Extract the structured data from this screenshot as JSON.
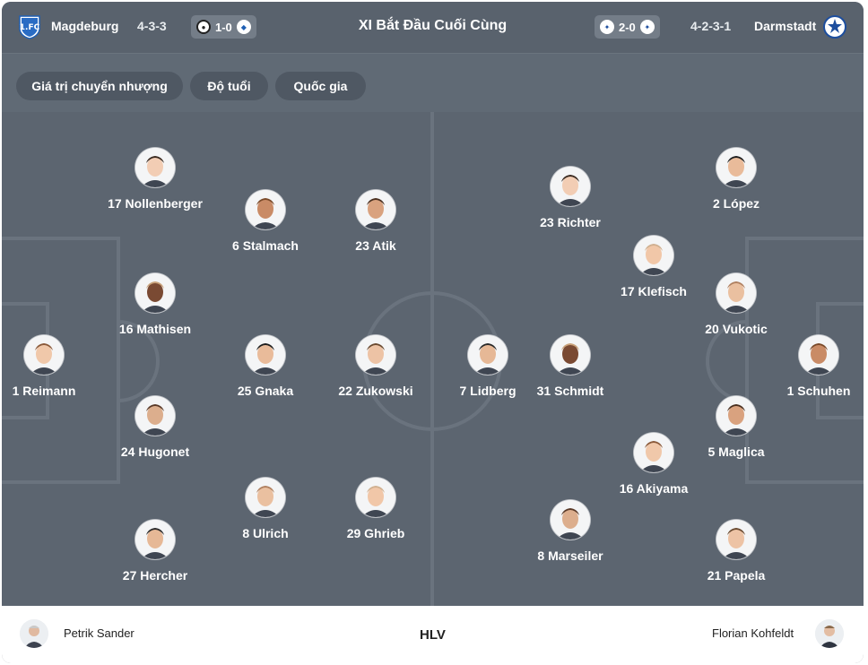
{
  "header": {
    "title": "XI Bắt Đầu Cuối Cùng",
    "home": {
      "name": "Magdeburg",
      "formation": "4-3-3",
      "logo_icon": "magdeburg-crest-icon",
      "color": "#1f5fb4"
    },
    "away": {
      "name": "Darmstadt",
      "formation": "4-2-3-1",
      "logo_icon": "darmstadt-crest-icon",
      "color": "#1d4e9e"
    },
    "home_result": {
      "score": "1-0"
    },
    "away_result": {
      "score": "2-0"
    }
  },
  "filters": [
    {
      "label": "Giá trị chuyển nhượng"
    },
    {
      "label": "Độ tuổi"
    },
    {
      "label": "Quốc gia"
    }
  ],
  "home_players": [
    {
      "label": "1 Reimann"
    },
    {
      "label": "17 Nollenberger"
    },
    {
      "label": "16 Mathisen"
    },
    {
      "label": "24 Hugonet"
    },
    {
      "label": "27 Hercher"
    },
    {
      "label": "6 Stalmach"
    },
    {
      "label": "25 Gnaka"
    },
    {
      "label": "8 Ulrich"
    },
    {
      "label": "23 Atik"
    },
    {
      "label": "22 Zukowski"
    },
    {
      "label": "29 Ghrieb"
    }
  ],
  "away_players": [
    {
      "label": "1 Schuhen"
    },
    {
      "label": "2 López"
    },
    {
      "label": "20 Vukotic"
    },
    {
      "label": "5 Maglica"
    },
    {
      "label": "21 Papela"
    },
    {
      "label": "17 Klefisch"
    },
    {
      "label": "16 Akiyama"
    },
    {
      "label": "23 Richter"
    },
    {
      "label": "31 Schmidt"
    },
    {
      "label": "8 Marseiler"
    },
    {
      "label": "7 Lidberg"
    }
  ],
  "coaches": {
    "label": "HLV",
    "home": "Petrik Sander",
    "away": "Florian Kohfeldt"
  }
}
